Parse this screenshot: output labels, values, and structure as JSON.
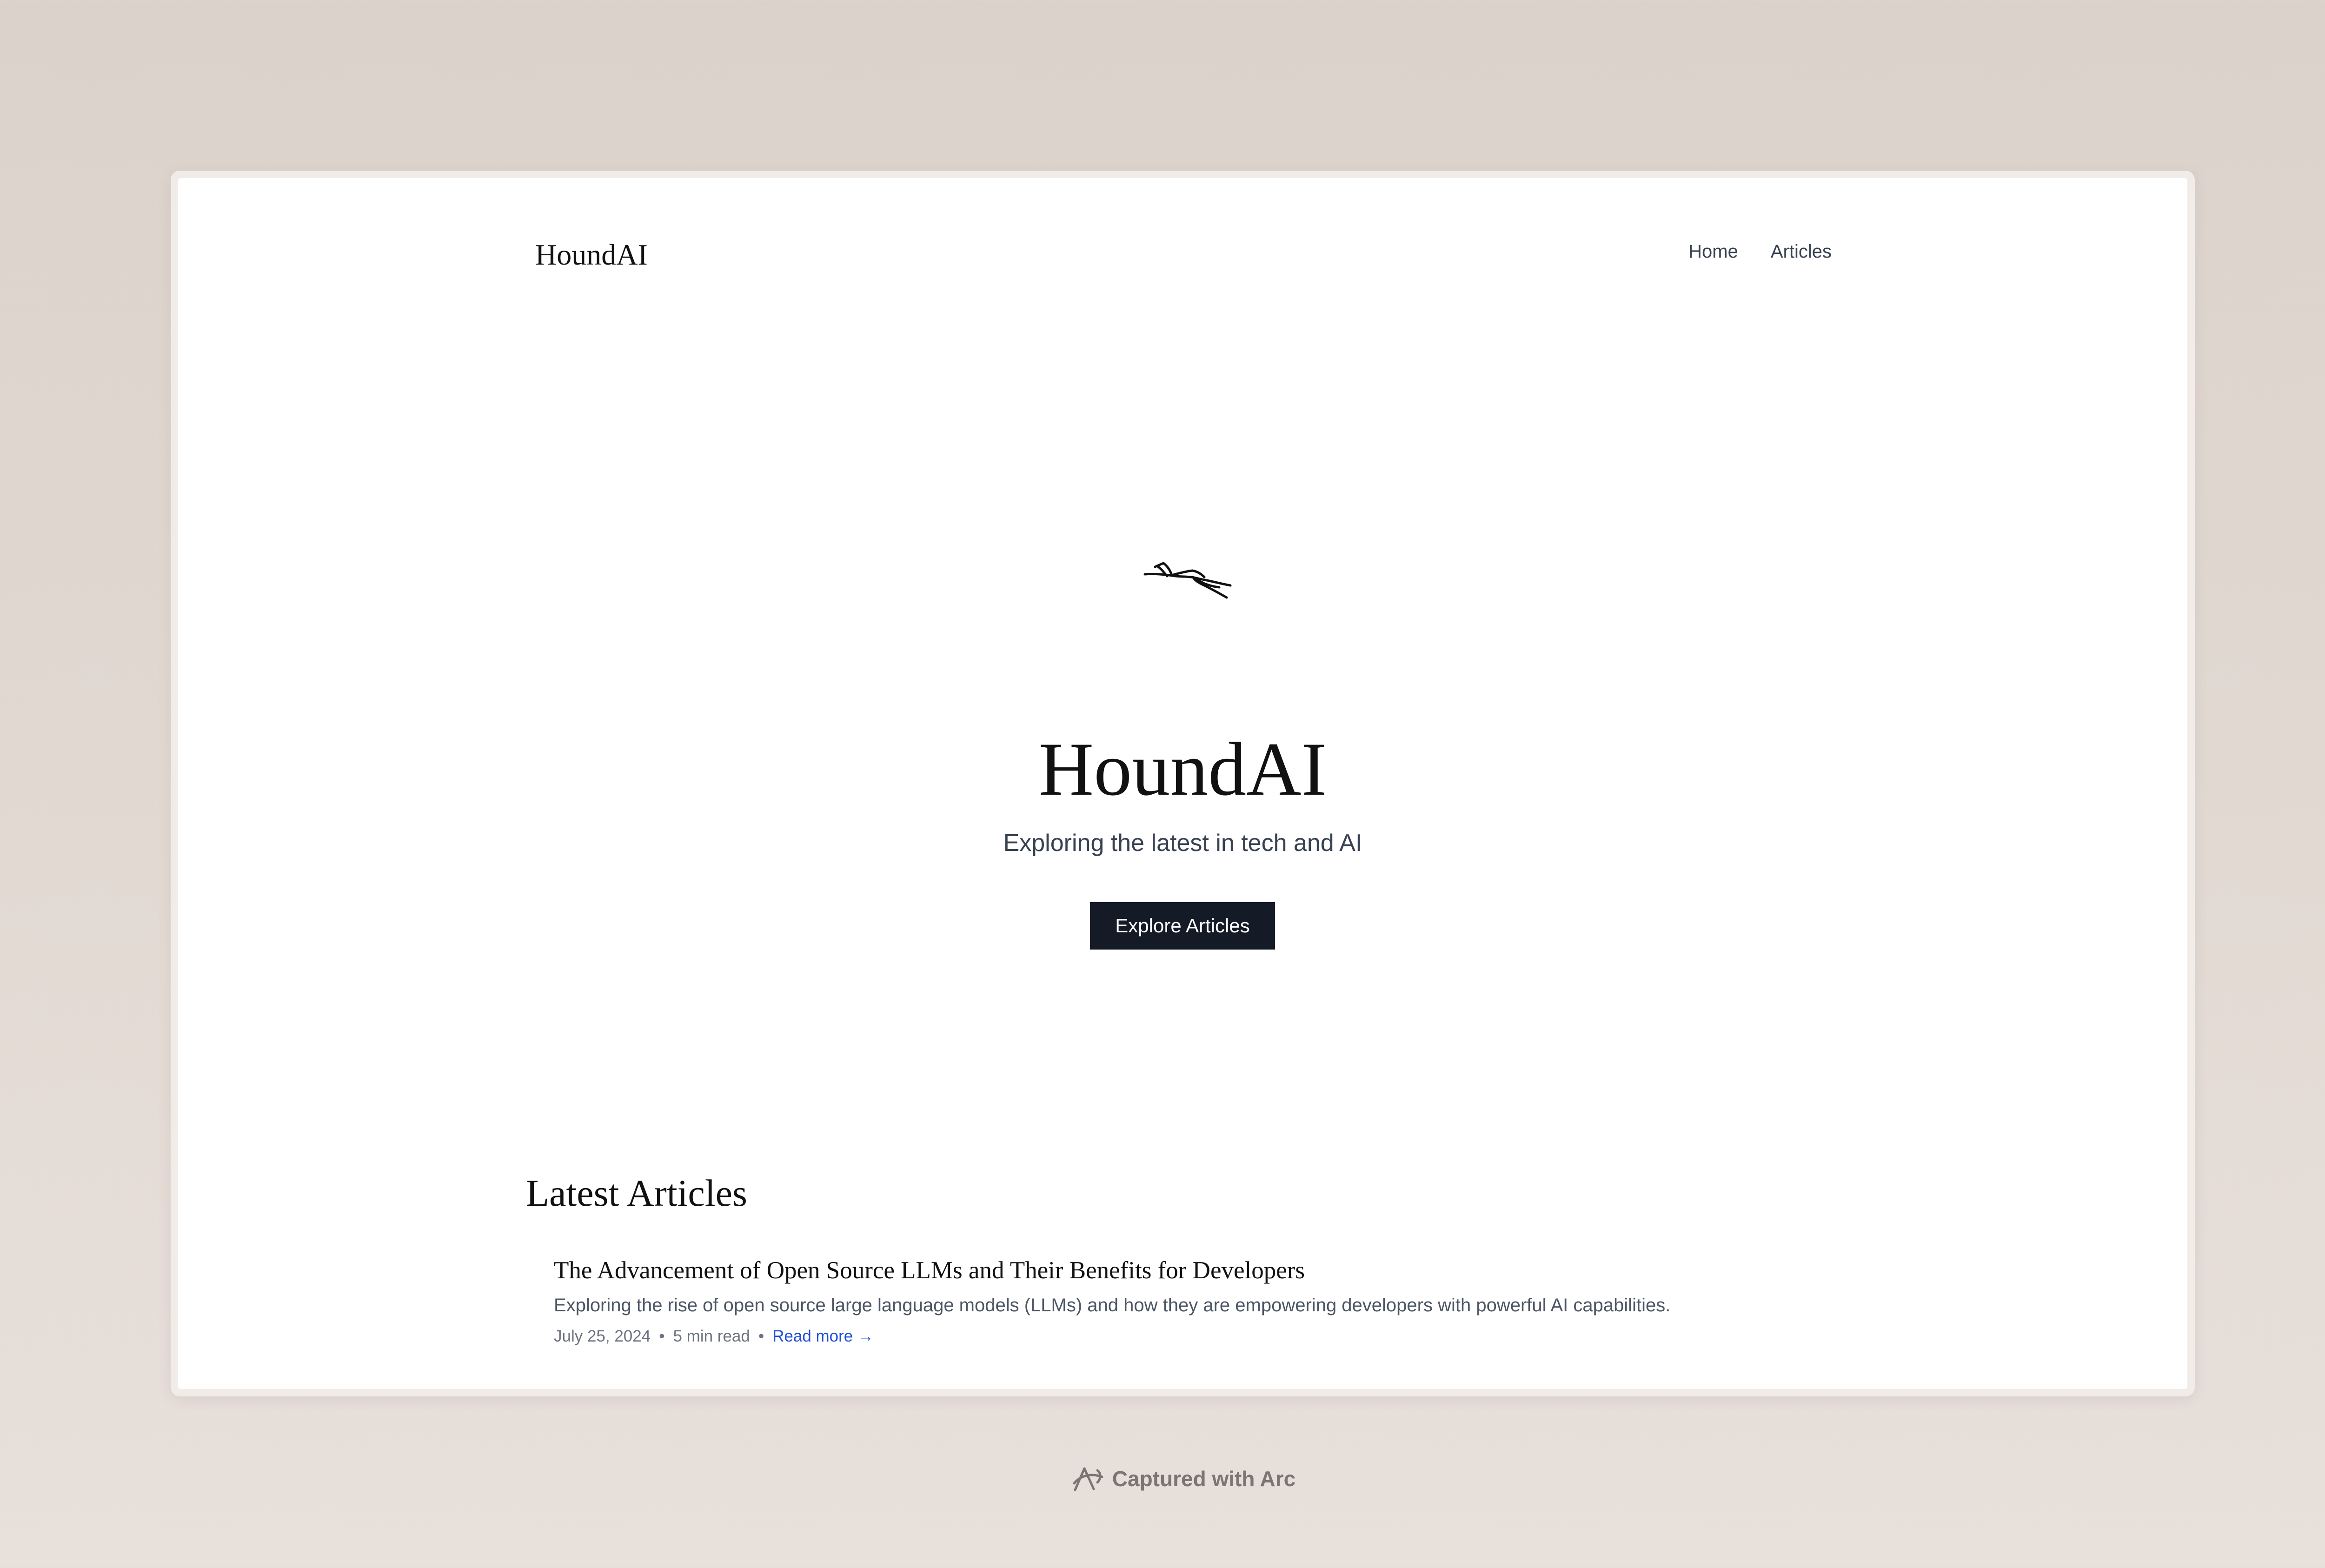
{
  "header": {
    "brand": "HoundAI",
    "nav": [
      "Home",
      "Articles"
    ]
  },
  "hero": {
    "icon": "running-hound-icon",
    "title": "HoundAI",
    "subtitle": "Exploring the latest in tech and AI",
    "cta_label": "Explore Articles"
  },
  "latest": {
    "heading": "Latest Articles",
    "articles": [
      {
        "title": "The Advancement of Open Source LLMs and Their Benefits for Developers",
        "excerpt": "Exploring the rise of open source large language models (LLMs) and how they are empowering developers with powerful AI capabilities.",
        "date": "July 25, 2024",
        "separator": "•",
        "read_time": "5 min read",
        "read_more": "Read more →"
      }
    ]
  },
  "footer": {
    "icon": "arc-logo-icon",
    "text": "Captured with Arc"
  },
  "colors": {
    "background": "#dcd2cc",
    "page": "#ffffff",
    "button": "#141a26",
    "link": "#1d4ed8"
  }
}
